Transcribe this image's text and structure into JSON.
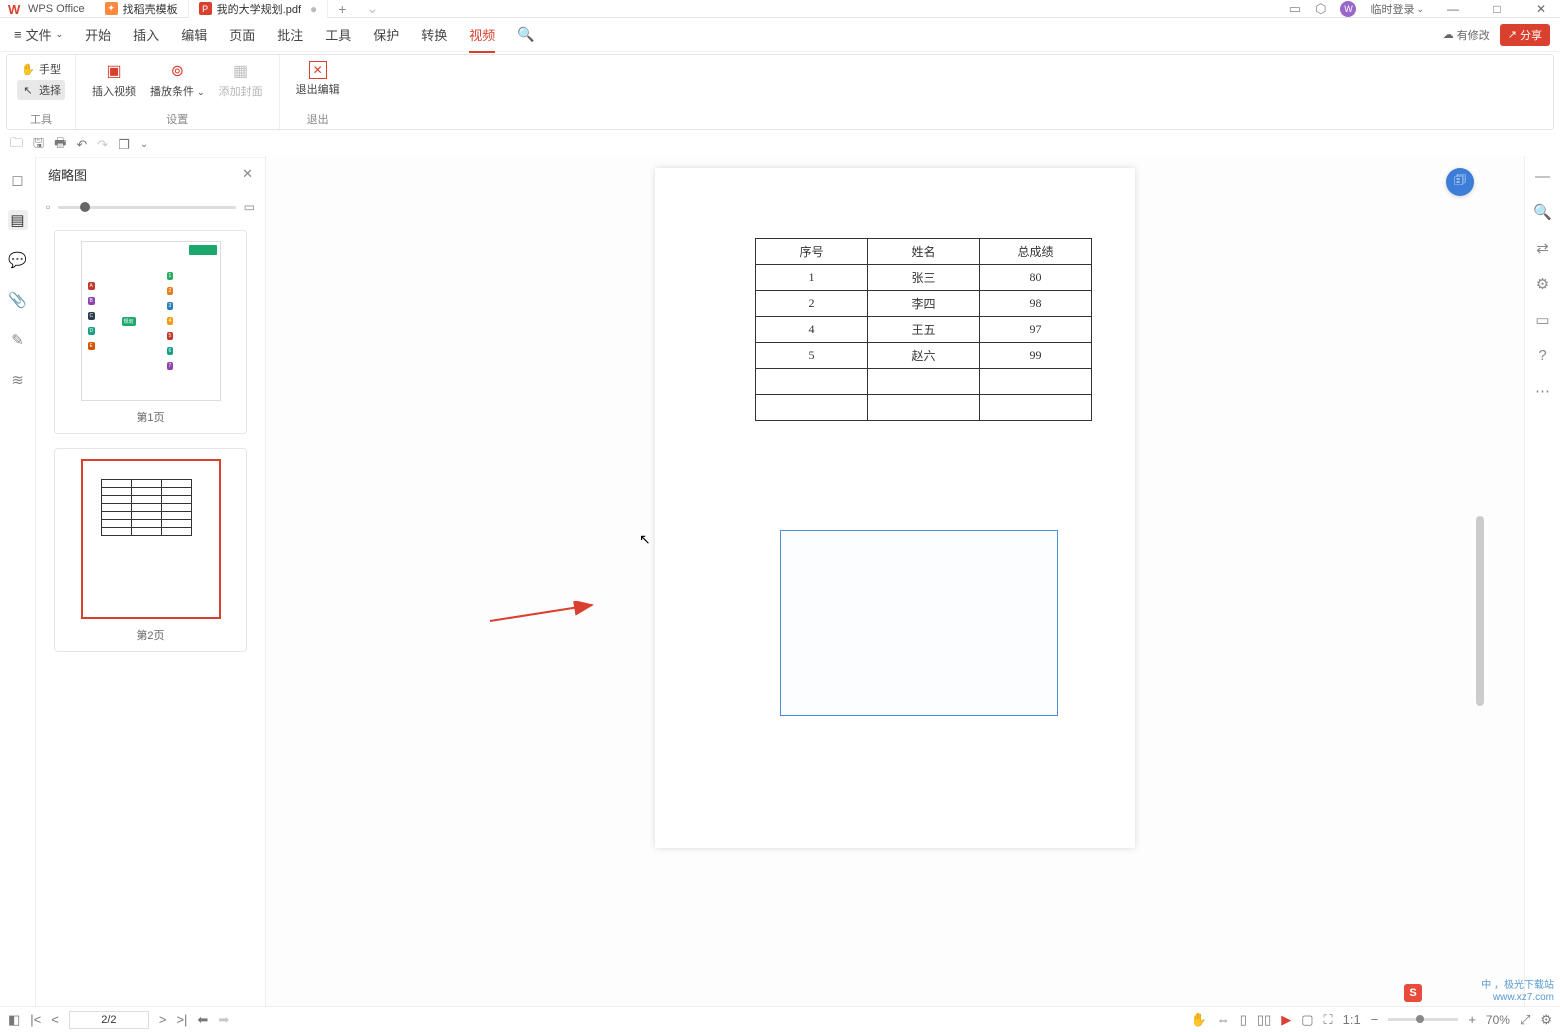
{
  "app": {
    "name": "WPS Office"
  },
  "tabs": [
    {
      "label": "找稻壳模板",
      "iconBg": "#ff8a3d"
    },
    {
      "label": "我的大学规划.pdf",
      "iconBg": "#d9412e",
      "iconTxt": "P",
      "active": true,
      "dirty": true
    }
  ],
  "titleRight": {
    "login": "临时登录"
  },
  "menu": {
    "file": "文件",
    "items": [
      "开始",
      "插入",
      "编辑",
      "页面",
      "批注",
      "工具",
      "保护",
      "转换",
      "视频"
    ],
    "activeIndex": 8
  },
  "menubarRight": {
    "hasChange": "有修改",
    "share": "分享"
  },
  "ribbon": {
    "g1": {
      "label": "工具",
      "hand": "手型",
      "select": "选择"
    },
    "g2": {
      "label": "设置",
      "insertVideo": "插入视频",
      "playCond": "播放条件",
      "addCover": "添加封面"
    },
    "g3": {
      "label": "退出",
      "exitEdit": "退出编辑"
    }
  },
  "thumbs": {
    "title": "缩略图",
    "pages": [
      "第1页",
      "第2页"
    ],
    "selected": 1
  },
  "document": {
    "table": {
      "headers": [
        "序号",
        "姓名",
        "总成绩"
      ],
      "rows": [
        [
          "1",
          "张三",
          "80"
        ],
        [
          "2",
          "李四",
          "98"
        ],
        [
          "4",
          "王五",
          "97"
        ],
        [
          "5",
          "赵六",
          "99"
        ],
        [
          "",
          "",
          ""
        ],
        [
          "",
          "",
          ""
        ]
      ]
    }
  },
  "status": {
    "page": "2/2",
    "zoom": "70%"
  },
  "watermark": {
    "l1": "中 ，极光下载站",
    "l2": "www.xz7.com"
  }
}
